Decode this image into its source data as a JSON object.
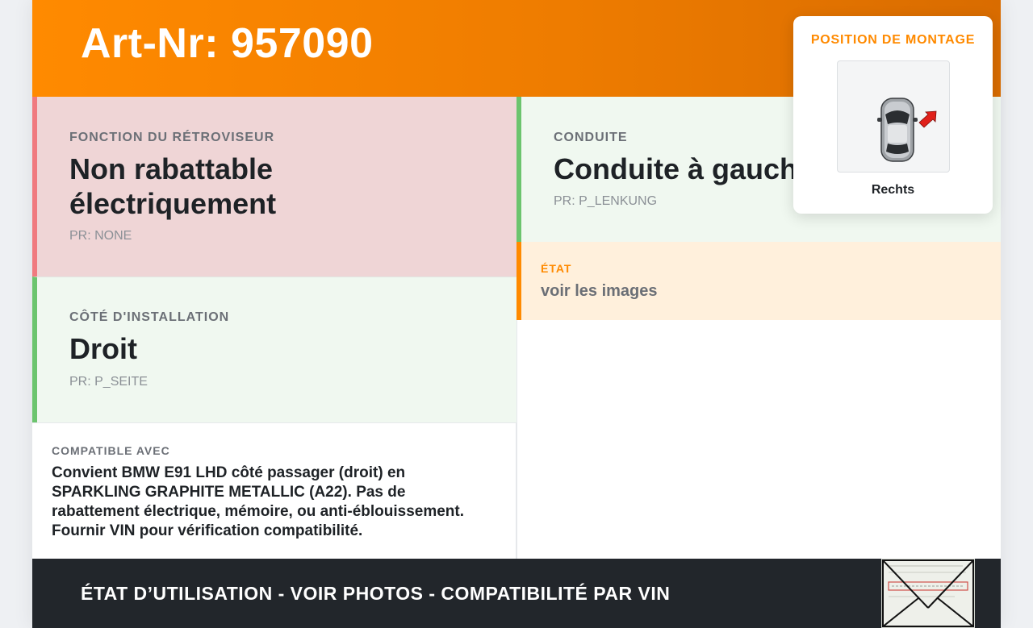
{
  "header": {
    "title": "Art-Nr: 957090"
  },
  "fonction": {
    "label": "FONCTION DU RÉTROVISEUR",
    "value_line1": "Non rabattable",
    "value_line2": "électriquement",
    "pr": "PR: NONE"
  },
  "cote": {
    "label": "CÔTÉ D'INSTALLATION",
    "value": "Droit",
    "pr": "PR: P_SEITE"
  },
  "compat": {
    "label": "COMPATIBLE AVEC",
    "line1": "Convient BMW E91 LHD côté passager (droit) en",
    "line2": "SPARKLING GRAPHITE METALLIC (A22). Pas de",
    "line3": "rabattement électrique, mémoire, ou anti-éblouissement.",
    "line4": "Fournir VIN pour vérification compatibilité."
  },
  "conduite": {
    "label": "CONDUITE",
    "value": "Conduite à gauche",
    "pr": "PR: P_LENKUNG"
  },
  "etat": {
    "label": "ÉTAT",
    "value": "voir les images"
  },
  "position_popup": {
    "title": "POSITION DE MONTAGE",
    "caption": "Rechts"
  },
  "footer": {
    "text": "ÉTAT D’UTILISATION - VOIR PHOTOS - COMPATIBILITÉ PAR VIN"
  },
  "colors": {
    "brand_orange": "#ff8a00",
    "warning_red": "#f07a7f",
    "ok_green": "#6cc46e",
    "footer_dark": "#22262b"
  }
}
